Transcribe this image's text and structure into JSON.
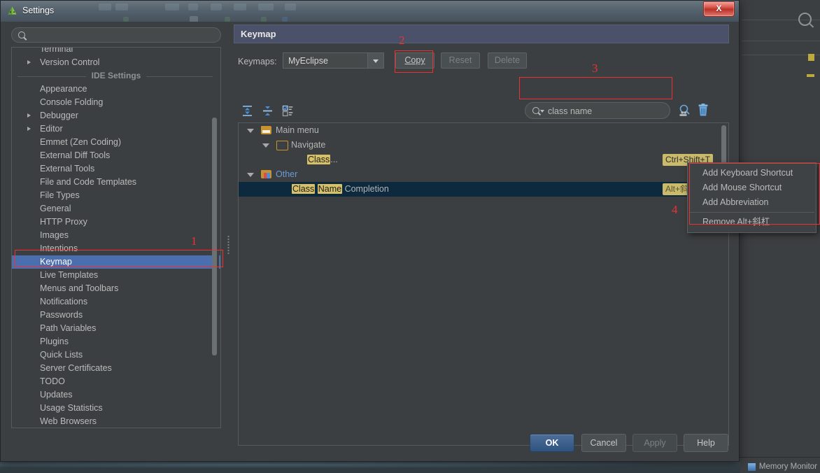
{
  "window": {
    "title": "Settings",
    "app_icon": "android-studio-icon",
    "close_label": "X"
  },
  "search": {
    "placeholder": "",
    "value": "",
    "icon": "search-icon"
  },
  "sidebar": {
    "top_items": [
      {
        "label": "Terminal",
        "expandable": false,
        "partial": true
      },
      {
        "label": "Version Control",
        "expandable": true
      }
    ],
    "section_label": "IDE Settings",
    "items": [
      {
        "label": "Appearance",
        "expandable": false
      },
      {
        "label": "Console Folding",
        "expandable": false
      },
      {
        "label": "Debugger",
        "expandable": true
      },
      {
        "label": "Editor",
        "expandable": true
      },
      {
        "label": "Emmet (Zen Coding)",
        "expandable": false
      },
      {
        "label": "External Diff Tools",
        "expandable": false
      },
      {
        "label": "External Tools",
        "expandable": false
      },
      {
        "label": "File and Code Templates",
        "expandable": false
      },
      {
        "label": "File Types",
        "expandable": false
      },
      {
        "label": "General",
        "expandable": false
      },
      {
        "label": "HTTP Proxy",
        "expandable": false
      },
      {
        "label": "Images",
        "expandable": false
      },
      {
        "label": "Intentions",
        "expandable": false
      },
      {
        "label": "Keymap",
        "expandable": false,
        "selected": true
      },
      {
        "label": "Live Templates",
        "expandable": false
      },
      {
        "label": "Menus and Toolbars",
        "expandable": false
      },
      {
        "label": "Notifications",
        "expandable": false
      },
      {
        "label": "Passwords",
        "expandable": false
      },
      {
        "label": "Path Variables",
        "expandable": false
      },
      {
        "label": "Plugins",
        "expandable": false
      },
      {
        "label": "Quick Lists",
        "expandable": false
      },
      {
        "label": "Server Certificates",
        "expandable": false
      },
      {
        "label": "TODO",
        "expandable": false
      },
      {
        "label": "Updates",
        "expandable": false
      },
      {
        "label": "Usage Statistics",
        "expandable": false
      },
      {
        "label": "Web Browsers",
        "expandable": false
      }
    ]
  },
  "keymap_panel": {
    "header_title": "Keymap",
    "keymaps_label": "Keymaps:",
    "keymaps_value": "MyEclipse",
    "buttons": {
      "copy": "Copy",
      "reset": "Reset",
      "delete": "Delete"
    },
    "toolbar_icons": [
      "expand-all-icon",
      "collapse-all-icon",
      "filter-icon"
    ],
    "shortcut_search": {
      "value": "class name",
      "icon": "search-icon",
      "find_by_shortcut_icon": "find-by-shortcut-icon",
      "clear_icon": "trash-icon"
    },
    "tree": [
      {
        "id": "main-menu",
        "label": "Main menu",
        "indent": 0,
        "expanded": true,
        "icon": "menu-folder-icon",
        "shortcut": ""
      },
      {
        "id": "navigate",
        "label": "Navigate",
        "indent": 1,
        "expanded": true,
        "icon": "folder-icon",
        "shortcut": ""
      },
      {
        "id": "class",
        "label_parts": [
          {
            "text": "Class",
            "highlight": true
          },
          {
            "text": "...",
            "highlight": false
          }
        ],
        "indent": 3,
        "icon": "",
        "shortcut": "Ctrl+Shift+T"
      },
      {
        "id": "other",
        "label": "Other",
        "indent": 0,
        "expanded": true,
        "icon": "other-folder-icon",
        "blue": true,
        "shortcut": ""
      },
      {
        "id": "class-name-completion",
        "label_parts": [
          {
            "text": "Class",
            "highlight": true
          },
          {
            "text": " ",
            "highlight": false
          },
          {
            "text": "Name",
            "highlight": true
          },
          {
            "text": " Completion",
            "highlight": false
          }
        ],
        "indent": 2,
        "icon": "",
        "selected": true,
        "shortcut": "Alt+斜杠"
      }
    ]
  },
  "context_menu": {
    "items": [
      {
        "label": "Add Keyboard Shortcut",
        "separator_after": false
      },
      {
        "label": "Add Mouse Shortcut",
        "separator_after": false
      },
      {
        "label": "Add Abbreviation",
        "separator_after": true
      },
      {
        "label": "Remove Alt+斜杠",
        "separator_after": false
      }
    ]
  },
  "dialog_buttons": {
    "ok": "OK",
    "cancel": "Cancel",
    "apply": "Apply",
    "help": "Help"
  },
  "annotations": [
    {
      "number": "1",
      "target": "sidebar-item-keymap"
    },
    {
      "number": "2",
      "target": "copy-button"
    },
    {
      "number": "3",
      "target": "shortcut-search-field"
    },
    {
      "number": "4",
      "target": "context-menu"
    }
  ],
  "background": {
    "status_text": "Memory Monitor"
  },
  "colors": {
    "accent": "#4b6eaf",
    "annotation": "#f03030",
    "highlight": "#d6c168",
    "selected_row": "#0d293e",
    "panel_bg": "#3c3f41"
  }
}
